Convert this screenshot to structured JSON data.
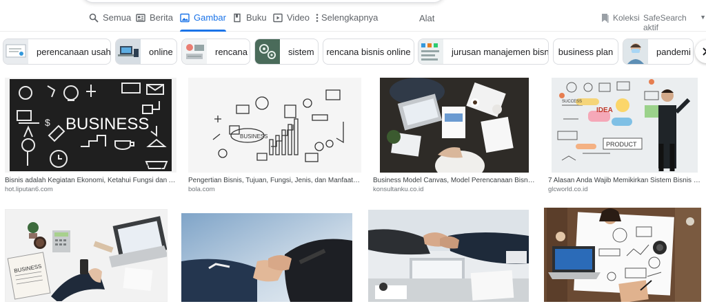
{
  "tabs": [
    {
      "label": "Semua",
      "icon": "search-icon"
    },
    {
      "label": "Berita",
      "icon": "news-icon"
    },
    {
      "label": "Gambar",
      "icon": "image-icon",
      "active": true
    },
    {
      "label": "Buku",
      "icon": "book-icon"
    },
    {
      "label": "Video",
      "icon": "video-icon"
    },
    {
      "label": "Selengkapnya",
      "icon": "more-vert-icon"
    }
  ],
  "tools_label": "Alat",
  "collections_label": "Koleksi",
  "safesearch_label": "SafeSearch aktif",
  "chips": [
    {
      "label": "perencanaan usaha",
      "has_thumb": true
    },
    {
      "label": "online",
      "has_thumb": true
    },
    {
      "label": "rencana",
      "has_thumb": true
    },
    {
      "label": "sistem",
      "has_thumb": true
    },
    {
      "label": "rencana bisnis online",
      "has_thumb": false
    },
    {
      "label": "jurusan manajemen bisnis",
      "has_thumb": true
    },
    {
      "label": "business plan",
      "has_thumb": false
    },
    {
      "label": "pandemi",
      "has_thumb": true
    }
  ],
  "results": [
    {
      "title": "Bisnis adalah Kegiatan Ekonomi, Ketahui Fungsi dan Ak...",
      "source": "hot.liputan6.com",
      "img_text": "BUSINESS",
      "img_subtext": "money"
    },
    {
      "title": "Pengertian Bisnis, Tujuan, Fungsi, Jenis, dan Manfaat ya...",
      "source": "bola.com",
      "img_text": "BUSINESS"
    },
    {
      "title": "Business Model Canvas, Model Perencanaan Bisnis ...",
      "source": "konsultanku.co.id"
    },
    {
      "title": "7 Alasan Anda Wajib Memikirkan Sistem Bisnis Se...",
      "source": "glcworld.co.id",
      "img_text": "IDEA",
      "img_subtext": "PRODUCT",
      "img_subtext2": "SUCCESS"
    },
    {
      "title": "",
      "source": "",
      "img_text": "BUSINESS"
    },
    {
      "title": "",
      "source": ""
    },
    {
      "title": "",
      "source": ""
    },
    {
      "title": "",
      "source": ""
    }
  ],
  "colors": {
    "accent": "#1a73e8",
    "muted": "#5f6368"
  }
}
